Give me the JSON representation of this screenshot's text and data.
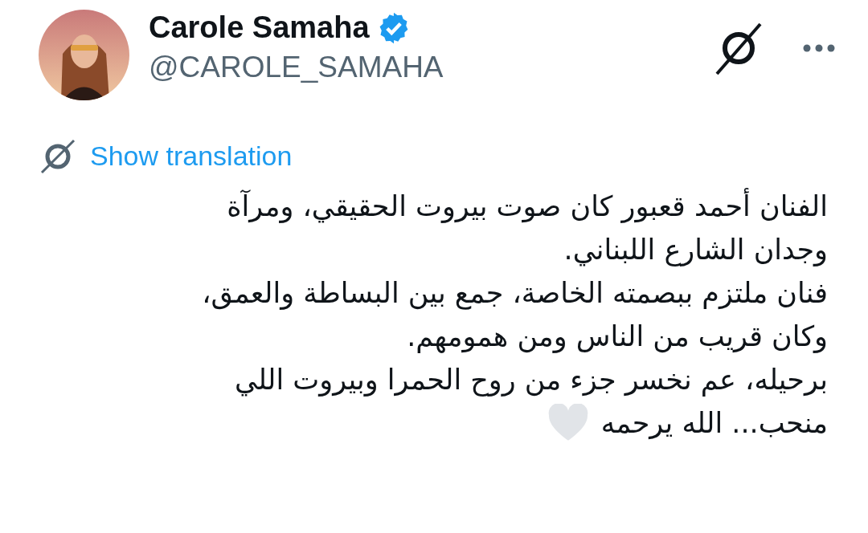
{
  "author": {
    "name": "Carole Samaha",
    "verified": true,
    "handle": "@CAROLE_SAMAHA"
  },
  "translate_link": "Show translation",
  "body_lines": [
    "الفنان أحمد قعبور كان صوت بيروت الحقيقي، ومرآة",
    "وجدان الشارع اللبناني.",
    "فنان ملتزم ببصمته الخاصة، جمع بين البساطة والعمق،",
    "وكان قريب من الناس ومن همومهم.",
    "برحيله، عم نخسر جزء من روح الحمرا وبيروت اللي",
    "منحب... الله يرحمه"
  ]
}
